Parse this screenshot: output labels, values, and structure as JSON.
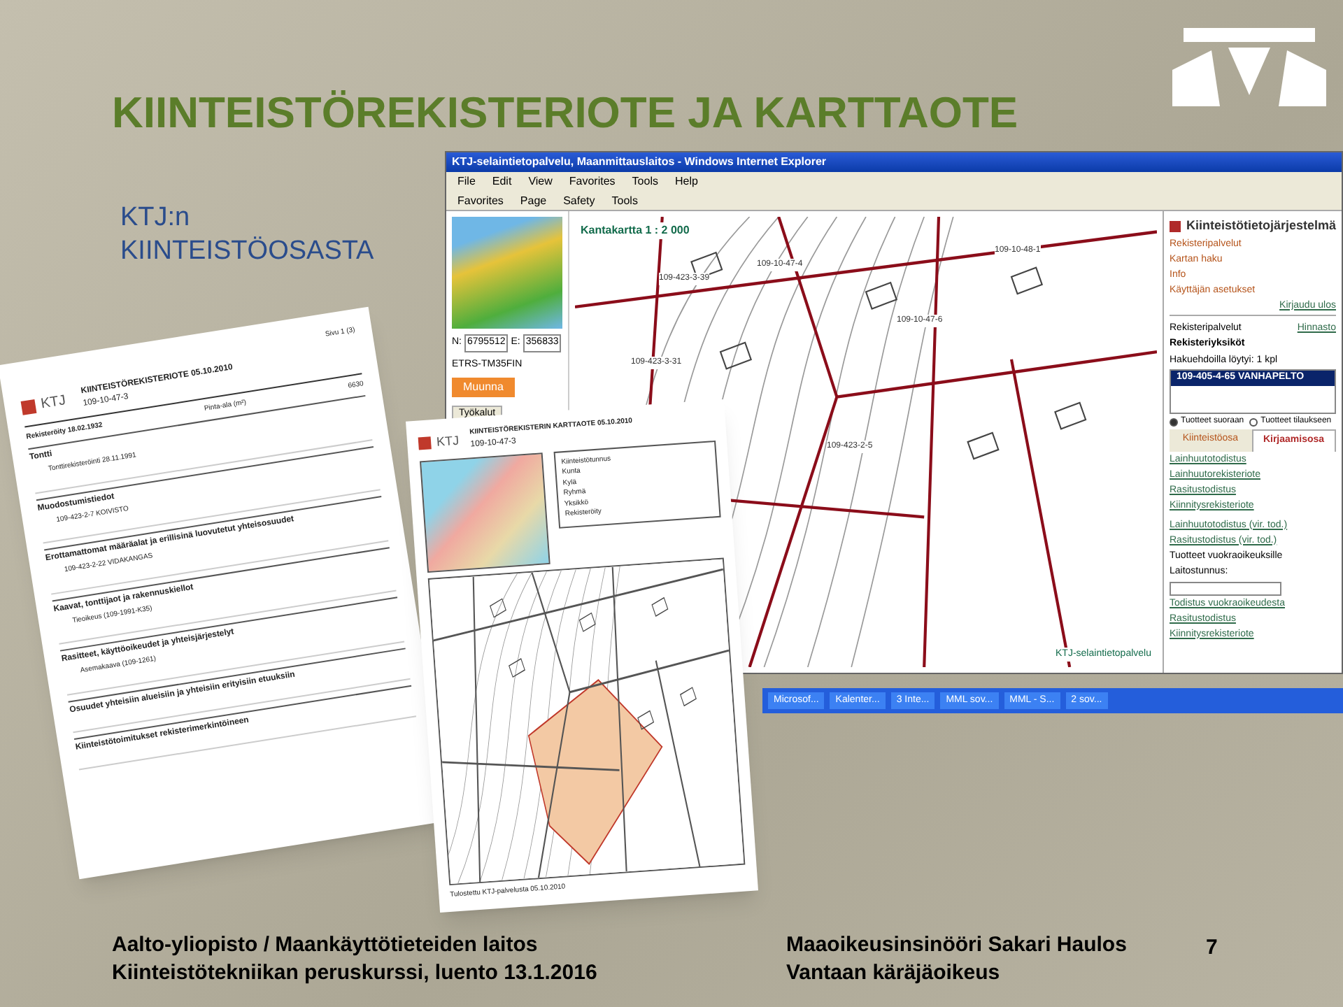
{
  "slide": {
    "title": "KIINTEISTÖREKISTERIOTE JA KARTTAOTE",
    "subtitle": [
      "KTJ:n",
      "KIINTEISTÖOSASTA"
    ]
  },
  "browser": {
    "title": "KTJ-selaintietopalvelu, Maanmittauslaitos - Windows Internet Explorer",
    "menu": [
      "File",
      "Edit",
      "View",
      "Favorites",
      "Tools",
      "Help"
    ],
    "toolbar": [
      "Favorites",
      "Page",
      "Safety",
      "Tools"
    ],
    "left": {
      "n_label": "N:",
      "n_value": "6795512",
      "e_label": "E:",
      "e_value": "356833",
      "crs": "ETRS-TM35FIN",
      "button": "Muunna",
      "tab": "Työkalut"
    },
    "map": {
      "scale": "Kantakartta 1 : 2 000",
      "footer": "KTJ-selaintietopalvelu",
      "parcels": [
        "109-423-3-39",
        "109-10-47-4",
        "109-423-3-31",
        "109-10-47-6",
        "109-10-48-1",
        "109-423-2-5"
      ]
    },
    "panel": {
      "heading": "Kiinteistötietojärjestelmä",
      "links": [
        "Rekisteripalvelut",
        "Kartan haku",
        "Info",
        "Käyttäjän asetukset"
      ],
      "logout": "Kirjaudu ulos",
      "section": "Rekisteripalvelut",
      "price": "Hinnasto",
      "units_title": "Rekisteriyksiköt",
      "found": "Hakuehdoilla löytyi:  1 kpl",
      "results": [
        {
          "label": "109-405-4-65   VANHAPELTO",
          "selected": true
        }
      ],
      "radios": [
        {
          "label": "Tuotteet suoraan",
          "selected": true
        },
        {
          "label": "Tuotteet tilaukseen",
          "selected": false
        }
      ],
      "tabs": [
        {
          "label": "Kiinteistöosa",
          "selected": false
        },
        {
          "label": "Kirjaamisosa",
          "selected": true
        }
      ],
      "products1": [
        "Lainhuutotodistus",
        "Lainhuutorekisteriote",
        "Rasitustodistus",
        "Kiinnitysrekisteriote"
      ],
      "products2": [
        "Lainhuutotodistus (vir. tod.)",
        "Rasitustodistus (vir. tod.)"
      ],
      "lease_title": "Tuotteet vuokraoikeuksille",
      "field_label": "Laitostunnus:",
      "products3": [
        "Todistus vuokraoikeudesta",
        "Rasitustodistus",
        "Kiinnitysrekisteriote"
      ]
    },
    "taskbar": [
      "Microsof...",
      "Kalenter...",
      "3 Inte...",
      "MML sov...",
      "MML - S...",
      "2 sov..."
    ]
  },
  "extract": {
    "page": "Sivu 1 (3)",
    "logo": "KTJ",
    "title": "KIINTEISTÖREKISTERIOTE 05.10.2010",
    "id": "109-10-47-3",
    "registered": "Rekisteröity 18.02.1932",
    "area_label": "Pinta-ala (m²)",
    "area": "6630",
    "sections": [
      "Tontti",
      "Muodostumistiedot",
      "Erottamattomat määräalat ja erillisinä luovutetut yhteisosuudet",
      "Kaavat, tonttijaot ja rakennuskiellot",
      "Rasitteet, käyttöoikeudet ja yhteisjärjestelyt",
      "Osuudet yhteisiin alueisiin ja yhteisiin erityisiin etuuksiin",
      "Kiinteistötoimitukset rekisterimerkintöineen"
    ],
    "rows": [
      "Tonttirekisteröinti  28.11.1991",
      "109-423-2-7 KOIVISTO",
      "109-423-2-22 VIDAKANGAS",
      "Tieoikeus (109-1991-K35)",
      "Asemakaava (109-1261)"
    ]
  },
  "map_extract": {
    "logo": "KTJ",
    "title": "KIINTEISTÖREKISTERIN KARTTAOTE 05.10.2010",
    "id": "109-10-47-3",
    "info": [
      "Kiinteistötunnus",
      "Kunta",
      "Kylä",
      "Ryhmä",
      "Yksikkö",
      "Rekisteröity"
    ],
    "footer": "Tulostettu KTJ-palvelusta 05.10.2010"
  },
  "footer": {
    "left": [
      "Aalto-yliopisto / Maankäyttötieteiden laitos",
      "Kiinteistötekniikan peruskurssi, luento 13.1.2016"
    ],
    "right": [
      "Maaoikeusinsinööri Sakari Haulos",
      "Vantaan käräjäoikeus"
    ],
    "page": "7"
  }
}
